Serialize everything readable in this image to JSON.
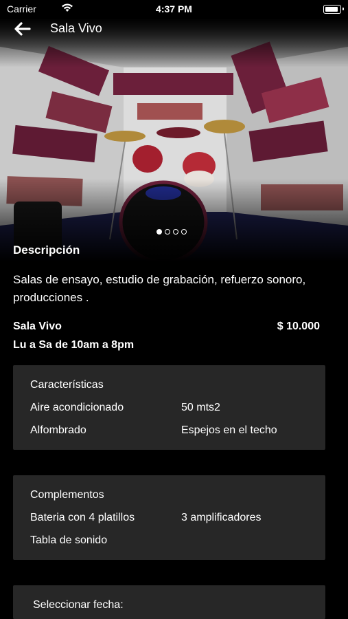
{
  "status_bar": {
    "carrier": "Carrier",
    "time": "4:37 PM"
  },
  "header": {
    "title": "Sala Vivo"
  },
  "carousel": {
    "page_count": 4,
    "active_index": 0
  },
  "description": {
    "heading": "Descripción",
    "text": " Salas de ensayo, estudio de grabación, refuerzo sonoro, producciones ."
  },
  "room": {
    "name": "Sala Vivo",
    "price": "$ 10.000",
    "hours": "Lu a Sa de 10am a 8pm"
  },
  "features": {
    "title": "Características",
    "items": [
      "Aire acondicionado",
      "50 mts2",
      "Alfombrado",
      "Espejos en el techo"
    ]
  },
  "complements": {
    "title": "Complementos",
    "items": [
      "Bateria con 4 platillos",
      "3 amplificadores",
      "Tabla de sonido"
    ]
  },
  "date_select": {
    "label": "Seleccionar fecha:"
  },
  "colors": {
    "background": "#000000",
    "card": "#272727",
    "panel": "#6b1f3a"
  }
}
